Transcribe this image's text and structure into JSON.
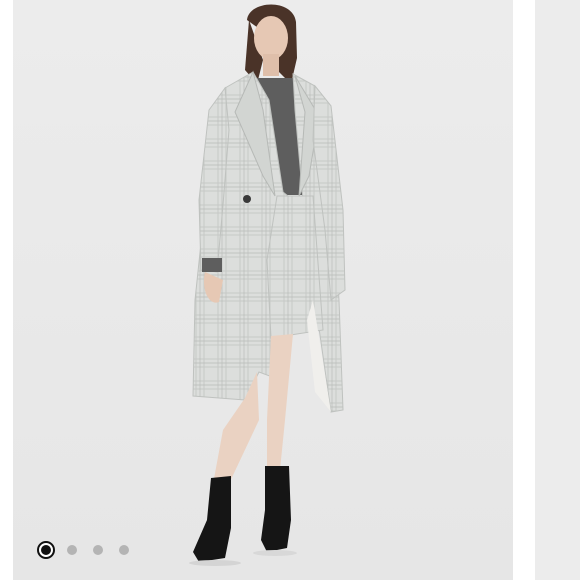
{
  "carousel": {
    "slide_count": 4,
    "active_index": 0,
    "current_image_icon": "photo-of-model-in-grey-plaid-coat",
    "next_image_icon": "photo-partial"
  },
  "colors": {
    "backdrop": "#ececec",
    "coat": "#d9dbd9",
    "sweater": "#5e5e5e",
    "boots": "#151515",
    "skin": "#e6c8b4",
    "hair": "#4a3328",
    "dot_active": "#111111",
    "dot_inactive": "#b4b4b4"
  }
}
